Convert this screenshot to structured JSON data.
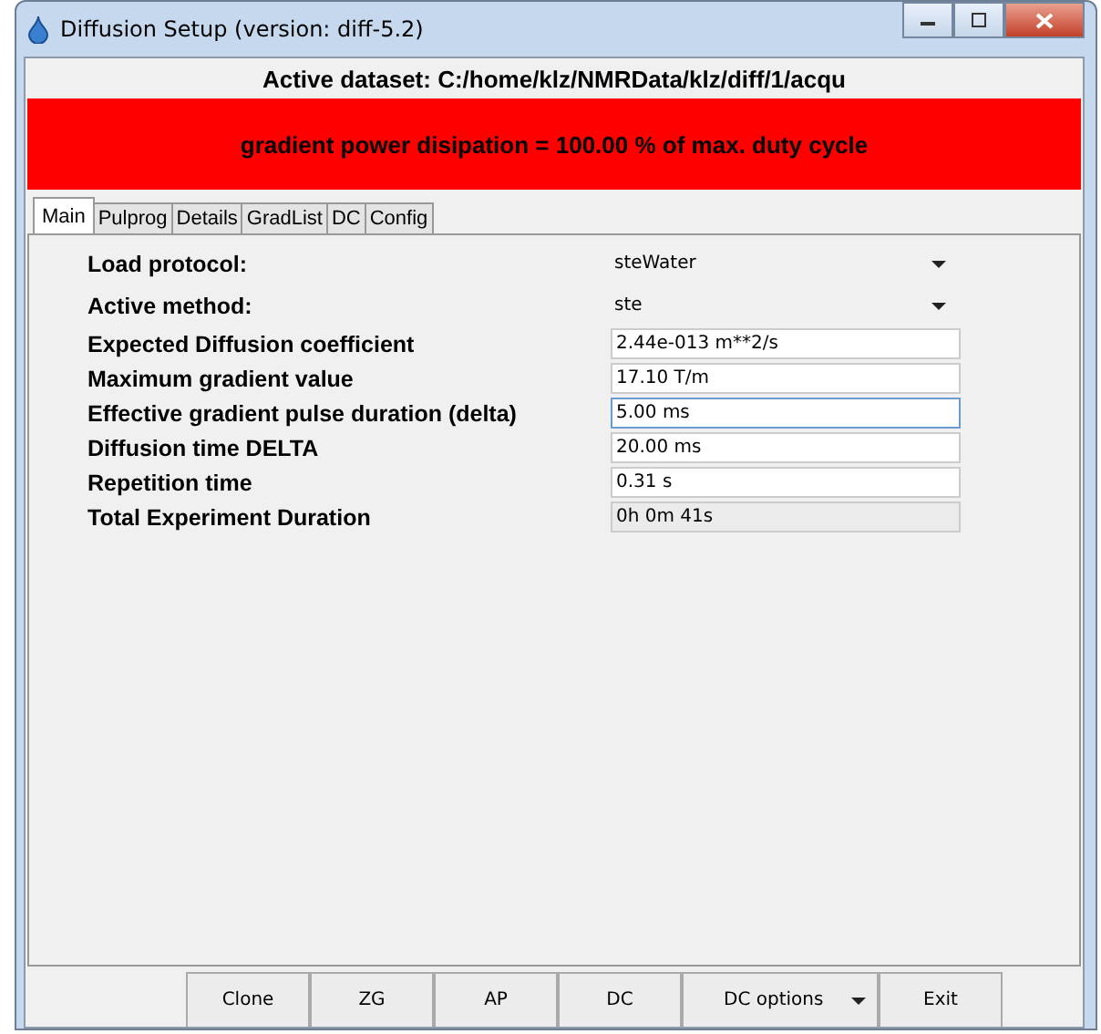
{
  "window": {
    "title": "Diffusion Setup (version: diff-5.2)"
  },
  "dataset": "Active dataset: C:/home/klz/NMRData/klz/diff/1/acqu",
  "warning": {
    "text": "gradient power disipation = 100.00 % of max. duty cycle",
    "color": "#ff0000"
  },
  "tabs": [
    {
      "label": "Main",
      "selected": true
    },
    {
      "label": "Pulprog",
      "selected": false
    },
    {
      "label": "Details",
      "selected": false
    },
    {
      "label": "GradList",
      "selected": false
    },
    {
      "label": "DC",
      "selected": false
    },
    {
      "label": "Config",
      "selected": false
    }
  ],
  "fields": [
    {
      "kind": "dropdown",
      "label": "Load protocol:",
      "value": "steWater"
    },
    {
      "kind": "dropdown",
      "label": "Active method:",
      "value": "ste"
    },
    {
      "kind": "input",
      "label": "Expected Diffusion coefficient",
      "value": "2.44e-013 m**2/s",
      "focused": false
    },
    {
      "kind": "input",
      "label": "Maximum gradient value",
      "value": "17.10 T/m",
      "focused": false
    },
    {
      "kind": "input",
      "label": "Effective gradient pulse duration (delta)",
      "value": "5.00 ms",
      "focused": true
    },
    {
      "kind": "input",
      "label": "Diffusion time DELTA",
      "value": "20.00 ms",
      "focused": false
    },
    {
      "kind": "input",
      "label": "Repetition time",
      "value": "0.31 s",
      "focused": false
    },
    {
      "kind": "readonly",
      "label": "Total Experiment Duration",
      "value": "0h 0m 41s"
    }
  ],
  "buttons": [
    {
      "kind": "button",
      "label": "Clone"
    },
    {
      "kind": "button",
      "label": "ZG"
    },
    {
      "kind": "button",
      "label": "AP"
    },
    {
      "kind": "button",
      "label": "DC"
    },
    {
      "kind": "menu",
      "label": "DC options"
    },
    {
      "kind": "button",
      "label": "Exit"
    }
  ]
}
